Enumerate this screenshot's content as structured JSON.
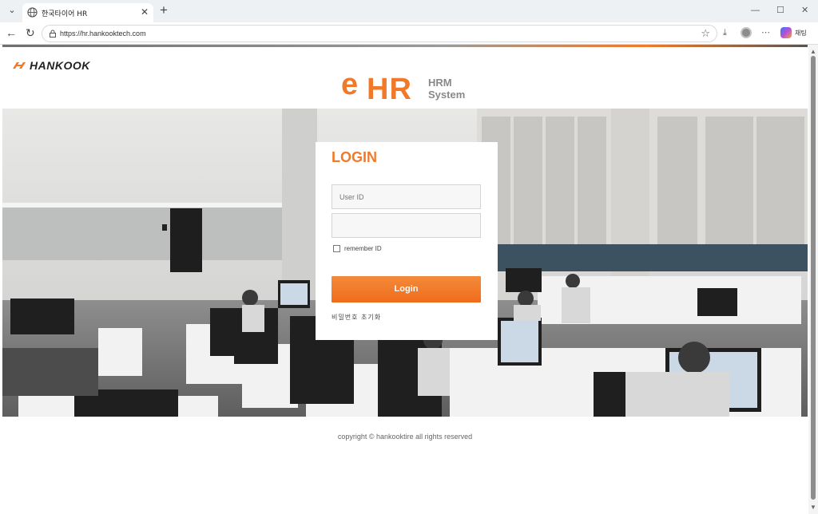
{
  "browser": {
    "tab_title": "한국타이어 HR",
    "url": "https://hr.hankooktech.com",
    "chat_label": "채팅",
    "icons": [
      "tab-list-icon",
      "globe-icon",
      "close-icon",
      "plus-icon",
      "minimize-icon",
      "maximize-icon",
      "back-arrow-icon",
      "reload-icon",
      "lock-icon",
      "star-icon",
      "download-icon",
      "profile-icon",
      "more-icon",
      "copilot-icon"
    ]
  },
  "header": {
    "logo_text": "HANKOOK",
    "ehr_e": "e",
    "ehr_hr": "HR",
    "ehr_sub_1": "HRM",
    "ehr_sub_2": "System"
  },
  "login": {
    "title": "LOGIN",
    "user_id_placeholder": "User ID",
    "password_value": "",
    "remember_label": "remember ID",
    "button_label": "Login",
    "reset_link": "비밀번호 초기화"
  },
  "footer": {
    "copyright": "copyright © hankooktire all rights reserved"
  },
  "colors": {
    "accent": "#f07a2a",
    "text_gray": "#888888"
  }
}
